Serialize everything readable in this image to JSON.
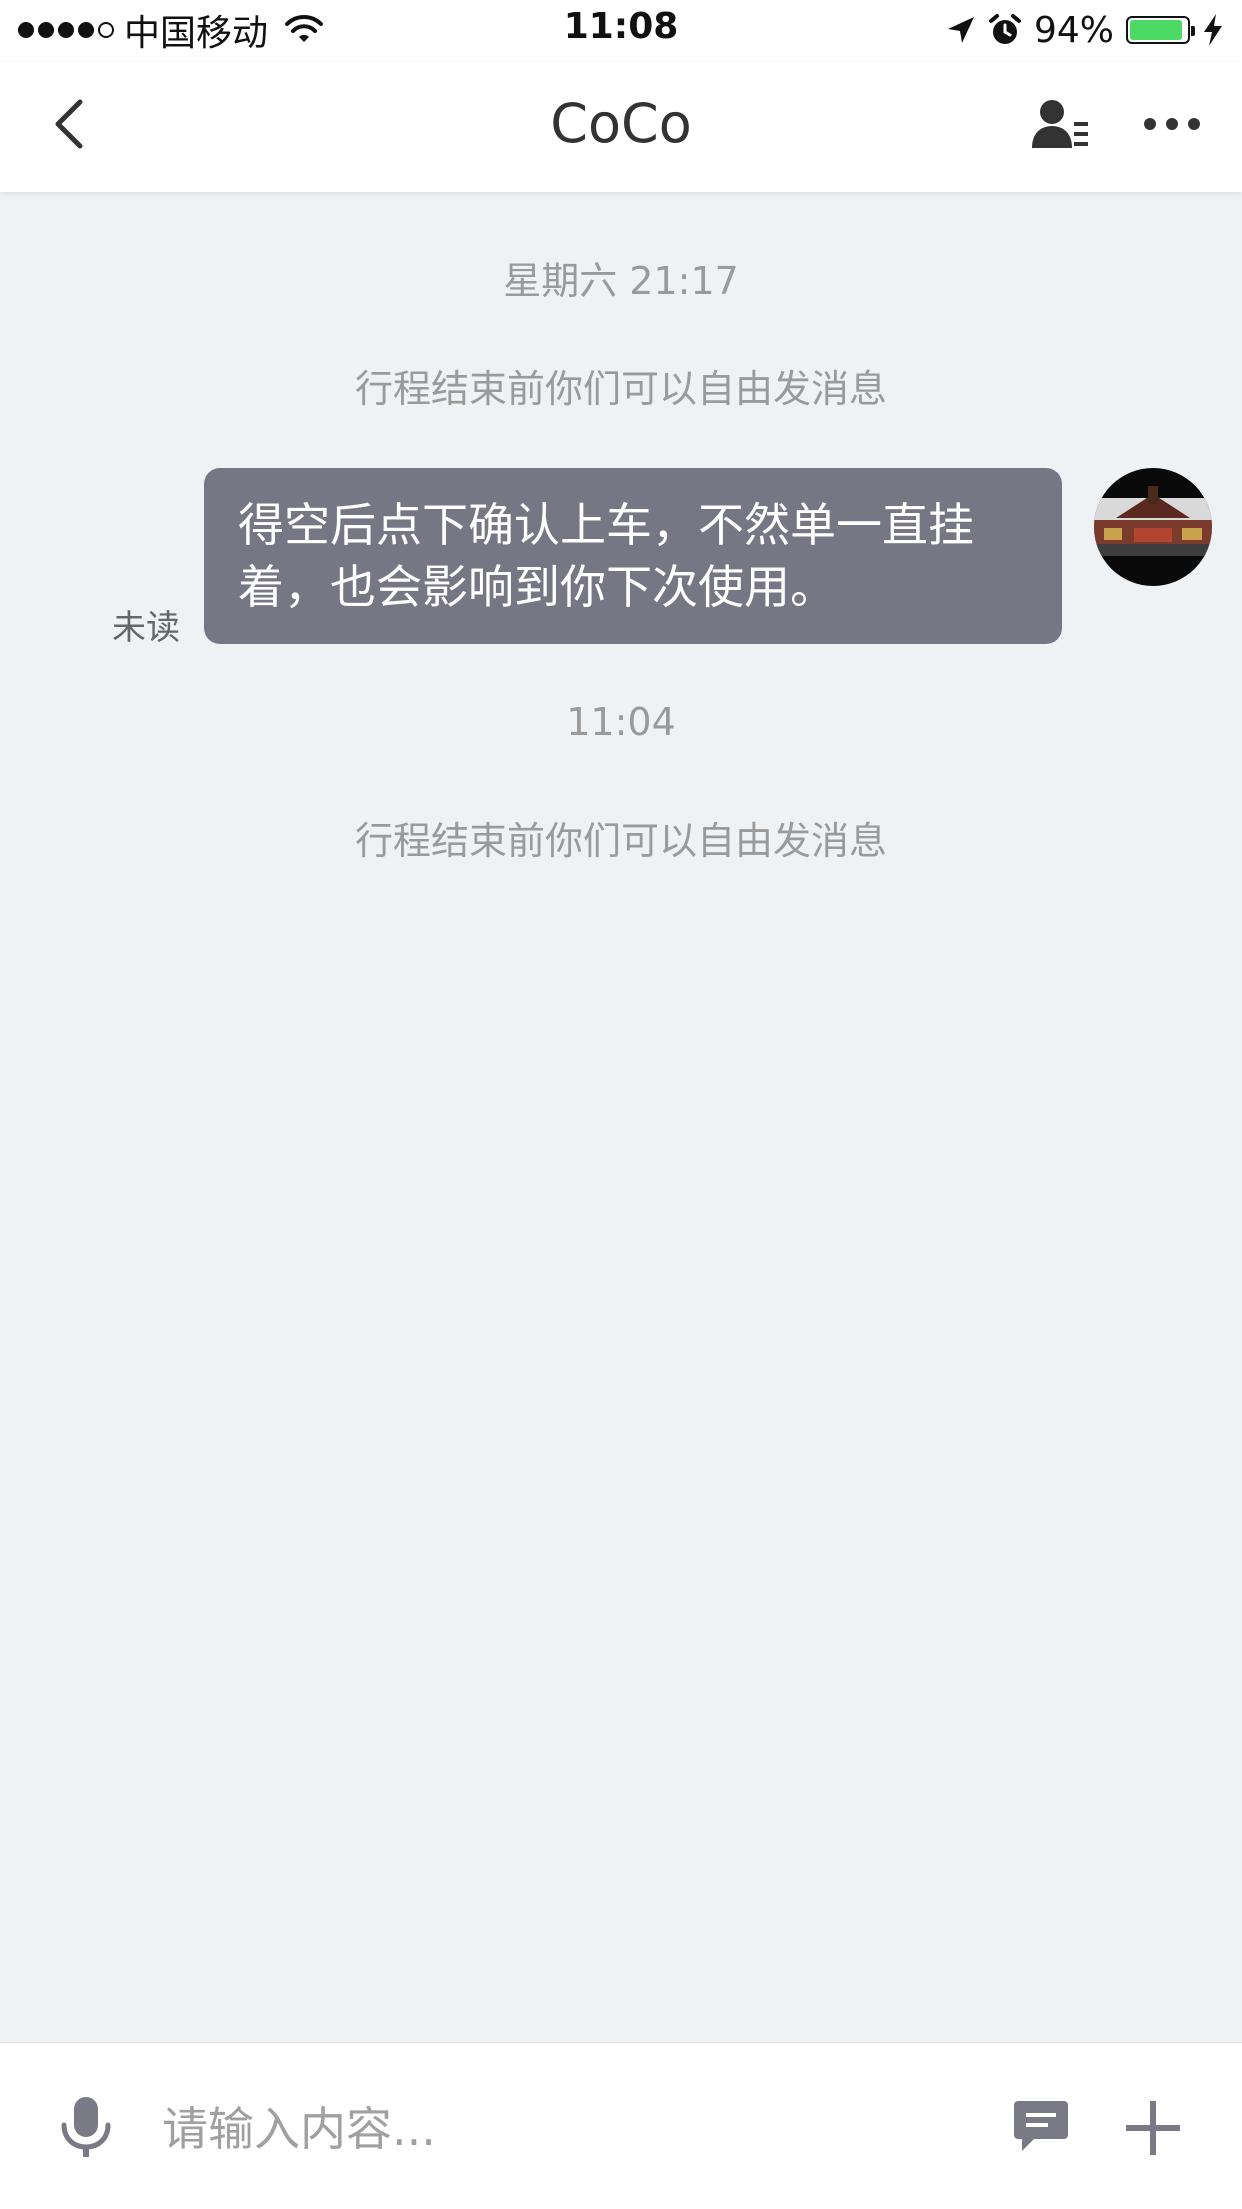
{
  "status_bar": {
    "carrier": "中国移动",
    "time": "11:08",
    "battery_percent": "94%",
    "battery_level": 0.94,
    "icons": [
      "signal-dots",
      "wifi-icon",
      "location-arrow-icon",
      "alarm-icon",
      "battery-icon",
      "charging-bolt-icon"
    ]
  },
  "nav": {
    "title": "CoCo",
    "back_icon": "chevron-left-icon",
    "profile_icon": "profile-icon",
    "more_icon": "more-icon"
  },
  "chat": {
    "items": [
      {
        "type": "timestamp",
        "text": "星期六 21:17"
      },
      {
        "type": "system",
        "text": "行程结束前你们可以自由发消息"
      },
      {
        "type": "message",
        "status": "未读",
        "text_line1": "得空后点下确认上车，不然单一直挂",
        "text_line2": "着，也会影响到你下次使用。"
      },
      {
        "type": "timestamp",
        "text": "11:04"
      },
      {
        "type": "system",
        "text": "行程结束前你们可以自由发消息"
      }
    ]
  },
  "input": {
    "placeholder": "请输入内容...",
    "mic_icon": "microphone-icon",
    "quick_reply_icon": "quick-reply-icon",
    "plus_icon": "plus-icon"
  },
  "colors": {
    "background": "#eff2f5",
    "bubble": "#767685",
    "muted_text": "#9a9a9a",
    "battery_fill": "#4cd964"
  }
}
